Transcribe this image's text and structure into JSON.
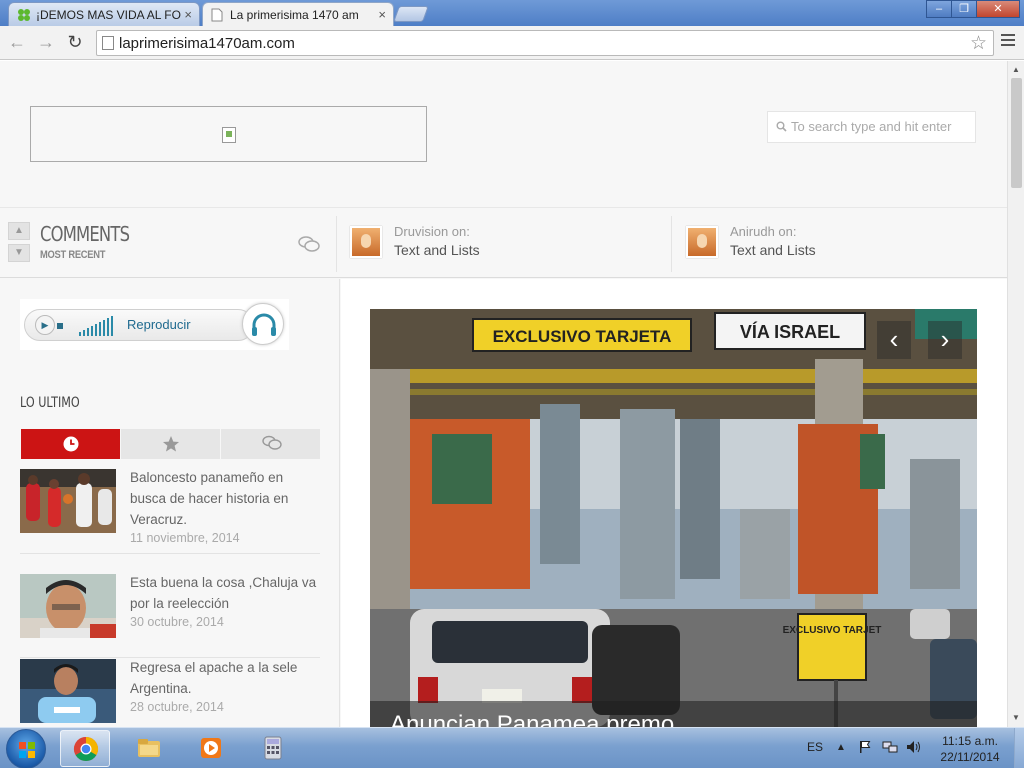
{
  "browser": {
    "tabs": [
      {
        "title": "¡DEMOS MAS VIDA AL FO",
        "close": "×"
      },
      {
        "title": "La primerisima 1470 am",
        "close": "×"
      }
    ],
    "window_controls": {
      "minimize": "–",
      "maximize": "❐",
      "close": "✕"
    },
    "nav": {
      "back": "←",
      "forward": "→",
      "reload": "↻"
    },
    "url": "laprimerisima1470am.com",
    "bookmark_star": "☆"
  },
  "header": {
    "search_placeholder": "To search type and hit enter"
  },
  "comments_bar": {
    "title": "COMMENTS",
    "subtitle": "MOST RECENT",
    "items": [
      {
        "author_line": "Druvision on:",
        "post": "Text and Lists"
      },
      {
        "author_line": "Anirudh on:",
        "post": "Text and Lists"
      }
    ]
  },
  "player": {
    "label": "Reproducir"
  },
  "sidebar": {
    "heading": "LO ULTIMO",
    "tabs": [
      {
        "name": "recent-clock-icon",
        "active": true
      },
      {
        "name": "popular-star-icon",
        "active": false
      },
      {
        "name": "comments-bubble-icon",
        "active": false
      }
    ],
    "posts": [
      {
        "title": "Baloncesto panameño en busca de hacer historia en Veracruz.",
        "date": "11 noviembre, 2014"
      },
      {
        "title": "Esta buena la cosa ,Chaluja va por la reelección",
        "date": "30 octubre, 2014"
      },
      {
        "title": "Regresa el apache a la sele Argentina.",
        "date": "28 octubre, 2014"
      }
    ]
  },
  "slider": {
    "prev": "‹",
    "next": "›",
    "sign_exclusivo": "EXCLUSIVO TARJETA",
    "sign_via": "VÍA ISRAEL",
    "sign_small": "EXCLUSIVO TARJET",
    "caption": "Anuncian Panamea premo..."
  },
  "taskbar": {
    "lang": "ES",
    "time": "11:15 a.m.",
    "date": "22/11/2014"
  },
  "colors": {
    "accent_red": "#cc1414",
    "player_blue": "#1f6a8f",
    "titlebar_blue": "#4e7ec6"
  }
}
